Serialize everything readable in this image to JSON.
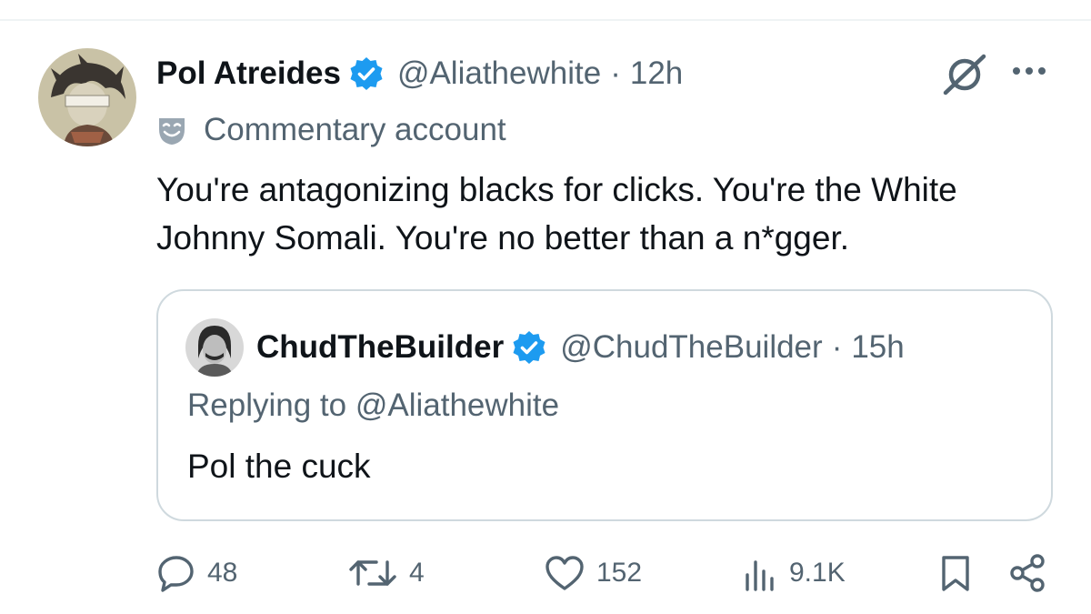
{
  "tweet": {
    "display_name": "Pol Atreides",
    "handle": "@Aliathewhite",
    "separator": "·",
    "time": "12h",
    "label": "Commentary account",
    "text": "You're antagonizing blacks for clicks.  You're the White Johnny Somali. You're no better than a n*gger."
  },
  "quote": {
    "display_name": "ChudTheBuilder",
    "handle": "@ChudTheBuilder",
    "separator": "·",
    "time": "15h",
    "replying_to": "Replying to @Aliathewhite",
    "text": "Pol the cuck"
  },
  "actions": {
    "replies": "48",
    "reposts": "4",
    "likes": "152",
    "views": "9.1K"
  },
  "icons": {
    "verified": "verified-badge-icon",
    "label": "theater-mask-icon",
    "grok": "grok-icon",
    "more": "more-icon",
    "reply": "reply-icon",
    "repost": "repost-icon",
    "like": "heart-icon",
    "views": "views-icon",
    "bookmark": "bookmark-icon",
    "share": "share-icon"
  },
  "colors": {
    "verified_blue": "#1d9bf0",
    "text_primary": "#0f1419",
    "text_secondary": "#536471",
    "border": "#cfd9de"
  }
}
